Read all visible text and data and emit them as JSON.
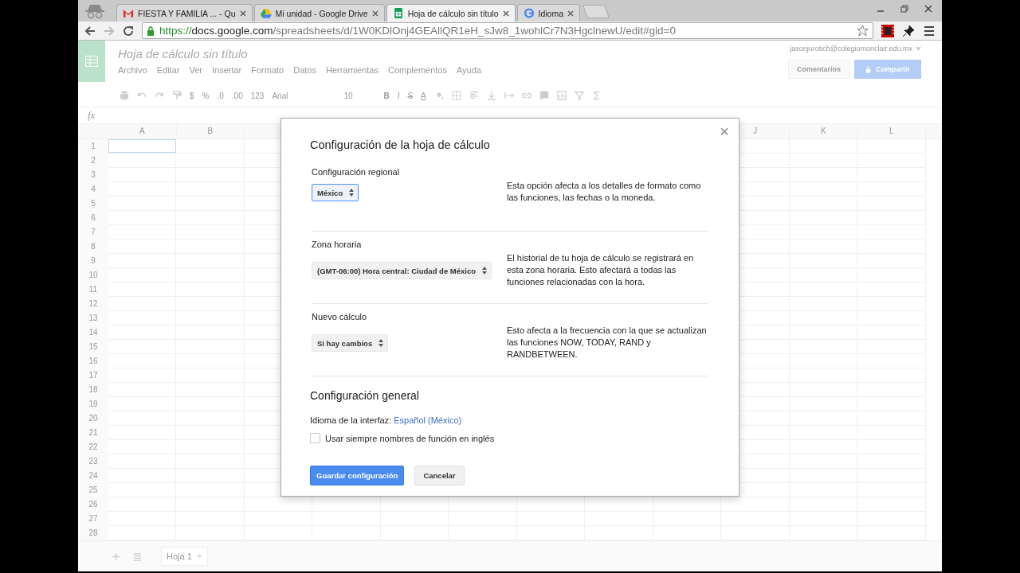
{
  "browser": {
    "tabs": [
      {
        "title": "FIESTA Y FAMILIA ... - Qu",
        "selected": false
      },
      {
        "title": "Mi unidad - Google Drive",
        "selected": false
      },
      {
        "title": "Hoja de cálculo sin título",
        "selected": true
      },
      {
        "title": "Idioma",
        "selected": false
      }
    ],
    "address": {
      "scheme": "https://",
      "host": "docs.google.com",
      "path": "/spreadsheets/d/1W0KDlOnj4GEAllQR1eH_sJw8_1wohlCr7N3HgclnewU/edit#gid=0"
    }
  },
  "document": {
    "title": "Hoja de cálculo sin título",
    "account": "jasonjurotich@colegiomonclair.edu.mx",
    "menu": [
      "Archivo",
      "Editar",
      "Ver",
      "Insertar",
      "Formato",
      "Datos",
      "Herramientas",
      "Complementos",
      "Ayuda"
    ],
    "buttons": {
      "comments": "Comentarios",
      "share": "Compartir"
    },
    "toolbar": [
      {
        "kind": "icon"
      },
      {
        "kind": "icon"
      },
      {
        "kind": "icon"
      },
      {
        "kind": "icon"
      },
      {
        "kind": "text",
        "text": "$"
      },
      {
        "kind": "text",
        "text": "%"
      },
      {
        "kind": "text",
        "text": ".0"
      },
      {
        "kind": "text",
        "text": ".00"
      },
      {
        "kind": "menu",
        "text": "123"
      },
      {
        "kind": "font",
        "text": "Arial"
      },
      {
        "kind": "size",
        "text": "10"
      },
      {
        "kind": "bold",
        "text": "B"
      },
      {
        "kind": "italic",
        "text": "I"
      },
      {
        "kind": "strike",
        "text": "S"
      },
      {
        "kind": "color",
        "text": "A"
      },
      {
        "kind": "icon"
      },
      {
        "kind": "icon"
      },
      {
        "kind": "icon"
      },
      {
        "kind": "icon"
      },
      {
        "kind": "icon"
      },
      {
        "kind": "icon"
      },
      {
        "kind": "icon"
      },
      {
        "kind": "icon"
      },
      {
        "kind": "icon"
      },
      {
        "kind": "icon"
      }
    ],
    "formula_label": "fx",
    "columns_left": [
      "A",
      "B"
    ],
    "columns_right": [
      "J",
      "K",
      "L"
    ],
    "rows": [
      "1",
      "2",
      "3",
      "4",
      "5",
      "6",
      "7",
      "8",
      "9",
      "10",
      "11",
      "12",
      "13",
      "14",
      "15",
      "16",
      "17",
      "18",
      "19",
      "20",
      "21",
      "22",
      "23",
      "24",
      "25",
      "26",
      "27",
      "28"
    ],
    "sheet_tab": "Hoja 1"
  },
  "dialog": {
    "title": "Configuración de la hoja de cálculo",
    "close": "×",
    "sections": [
      {
        "label": "Configuración regional",
        "value": "México",
        "focused": true,
        "description": "Esta opción afecta a los detalles de formato como las funciones, las fechas o la moneda."
      },
      {
        "label": "Zona horaria",
        "value": "(GMT-06:00) Hora central: Ciudad de México",
        "focused": false,
        "description": "El historial de tu hoja de cálculo se registrará en esta zona horaria. Esto afectará a todas las funciones relacionadas con la hora."
      },
      {
        "label": "Nuevo cálculo",
        "value": "Si hay cambios",
        "focused": false,
        "description": "Esto afecta a la frecuencia con la que se actualizan las funciones NOW, TODAY, RAND y RANDBETWEEN."
      }
    ],
    "general_title": "Configuración general",
    "language_label": "Idioma de la interfaz:",
    "language_link": "Español (México)",
    "checkbox": {
      "label": "Usar siempre nombres de función en inglés",
      "checked": false
    },
    "save": "Guardar configuración",
    "cancel": "Cancelar"
  }
}
